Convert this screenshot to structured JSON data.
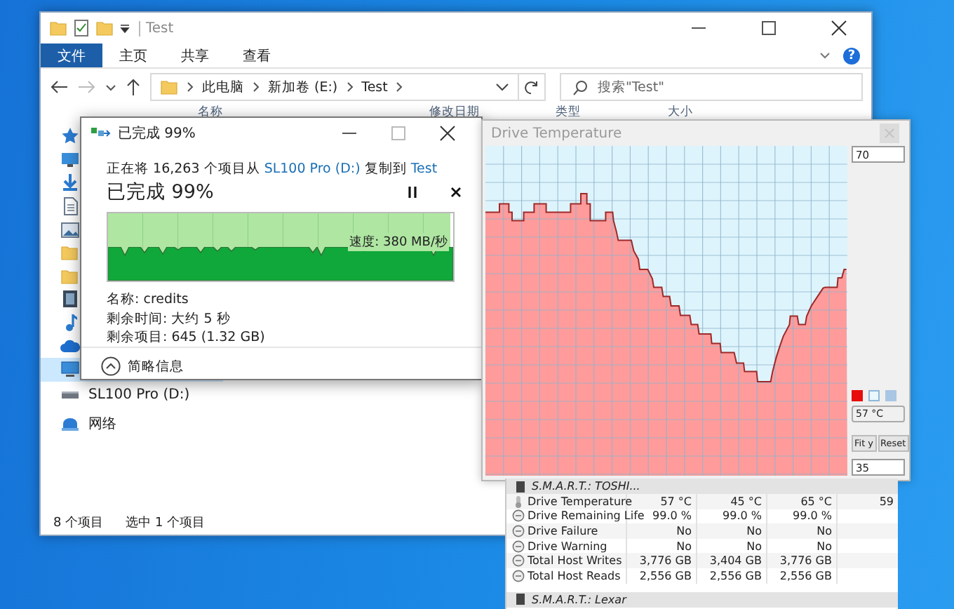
{
  "explorer": {
    "title": "Test",
    "ribbon_tabs": [
      {
        "label": "文件",
        "selected": true
      },
      {
        "label": "主页",
        "selected": false
      },
      {
        "label": "共享",
        "selected": false
      },
      {
        "label": "查看",
        "selected": false
      }
    ],
    "help": "?",
    "breadcrumb": [
      "此电脑",
      "新加卷 (E:)",
      "Test"
    ],
    "search": {
      "placeholder": "搜索\"Test\""
    },
    "columns": [
      "名称",
      "修改日期",
      "类型",
      "大小"
    ],
    "sidebar": [
      {
        "kind": "star",
        "selected": false
      },
      {
        "kind": "desktop",
        "selected": false
      },
      {
        "kind": "download",
        "selected": false
      },
      {
        "kind": "document",
        "selected": false
      },
      {
        "kind": "picture",
        "selected": false
      },
      {
        "kind": "folder",
        "selected": false
      },
      {
        "kind": "folder",
        "selected": false
      },
      {
        "kind": "video",
        "selected": false
      },
      {
        "kind": "music",
        "selected": false
      },
      {
        "kind": "cloud",
        "selected": false
      },
      {
        "kind": "pc",
        "selected": true
      },
      {
        "kind": "drive",
        "label": "SL100 Pro (D:)",
        "selected": false
      },
      {
        "kind": "network",
        "label": "网络",
        "selected": false
      }
    ],
    "status_bar": [
      "8 个项目",
      "选中 1 个项目"
    ]
  },
  "copy_dialog": {
    "title": "已完成 99%",
    "prefix": "正在将 16,263 个项目从",
    "source": "SL100 Pro (D:)",
    "middle": "复制到",
    "destination": "Test",
    "heading": "已完成 99%",
    "level": 0.99,
    "speed": "速度: 380 MB/秒",
    "details": [
      "名称: credits",
      "剩余时间: 大约 5 秒",
      "剩余项目: 645 (1.32 GB)"
    ],
    "details_toggle": "简略信息"
  },
  "temperature_window": {
    "title": "Drive Temperature",
    "max": "70",
    "min": "35",
    "current": "57 °C",
    "fit_button": "Fit y",
    "reset_button": "Reset",
    "swatches": [
      {
        "color": "#e80c0c"
      },
      {
        "color": "#eaf7fd"
      },
      {
        "color": "#a9c6e4"
      }
    ]
  },
  "smart": {
    "header": "S.M.A.R.T.: TOSHI...",
    "rows": [
      {
        "kind": "temperature",
        "name": "Drive Temperature",
        "values": [
          "57 °C",
          "45 °C",
          "65 °C",
          "59"
        ]
      },
      {
        "kind": "status",
        "name": "Drive Remaining Life",
        "values": [
          "99.0 %",
          "99.0 %",
          "99.0 %"
        ]
      },
      {
        "kind": "status",
        "name": "Drive Failure",
        "values": [
          "No",
          "No",
          "No"
        ]
      },
      {
        "kind": "status",
        "name": "Drive Warning",
        "values": [
          "No",
          "No",
          "No"
        ]
      },
      {
        "kind": "status",
        "name": "Total Host Writes",
        "values": [
          "3,776 GB",
          "3,404 GB",
          "3,776 GB"
        ]
      },
      {
        "kind": "status",
        "name": "Total Host Reads",
        "values": [
          "2,556 GB",
          "2,556 GB",
          "2,556 GB"
        ]
      }
    ],
    "next_header": "S.M.A.R.T.: Lexar"
  }
}
